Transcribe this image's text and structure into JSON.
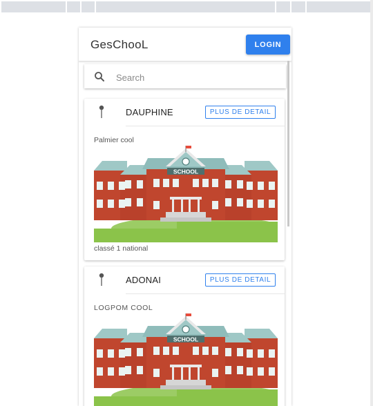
{
  "app": {
    "title": "GesChooL",
    "login_label": "LOGIN"
  },
  "search": {
    "placeholder": "Search",
    "value": ""
  },
  "schools": [
    {
      "name": "DAUPHINE",
      "detail_label": "PLUS DE DETAIL",
      "subtitle": "Palmier cool",
      "sign": "SCHOOL",
      "footer": "classé 1 national"
    },
    {
      "name": "ADONAI",
      "detail_label": "PLUS DE DETAIL",
      "subtitle": "LOGPOM COOL",
      "sign": "SCHOOL",
      "footer": ""
    }
  ],
  "colors": {
    "accent": "#2f80ed",
    "brick": "#c0462e",
    "roof": "#9fc8c6",
    "grass": "#8bc34a"
  }
}
